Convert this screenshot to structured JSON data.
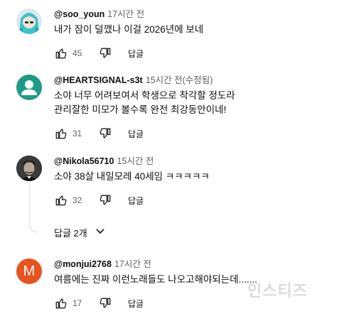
{
  "comments": [
    {
      "author": "@soo_youn",
      "time": "17시간 전",
      "lines": [
        "내가 잠이 덜깼나 이걸 2026년에 보네"
      ],
      "likes": "45",
      "reply_label": "답글",
      "avatar": "anime-character-avatar"
    },
    {
      "author": "@HEARTSIGNAL-s3t",
      "time": "15시간 전(수정됨)",
      "lines": [
        "소야 너무 어려보여서 학생으로 착각할 정도라",
        "관리잘한 미모가 볼수록 완전 최강동안이네!"
      ],
      "likes": "31",
      "reply_label": "답글",
      "avatar": "default-user-avatar",
      "avatar_color": "#1e9b84"
    },
    {
      "author": "@Nikola56710",
      "time": "15시간 전",
      "lines": [
        "소야 38살 내일모레 40세임 ㅋㅋㅋㅋㅋ"
      ],
      "likes": "32",
      "reply_label": "답글",
      "avatar": "portrait-photo-avatar",
      "replies_toggle": "답글 2개"
    },
    {
      "author": "@monjui2768",
      "time": "17시간 전",
      "lines": [
        "여름에는 진짜 이런노래들도 나오고해야되는데......."
      ],
      "likes": "17",
      "reply_label": "답글",
      "avatar": "letter-avatar",
      "avatar_letter": "M",
      "avatar_color": "#e8531f"
    }
  ],
  "watermark": "인스티즈"
}
